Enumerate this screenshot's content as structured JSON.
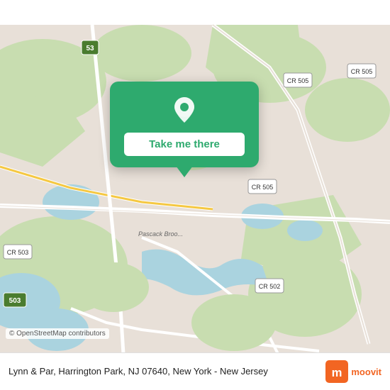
{
  "map": {
    "alt": "Map of Harrington Park, NJ area"
  },
  "popup": {
    "button_label": "Take me there"
  },
  "bottom_bar": {
    "address": "Lynn & Par, Harrington Park, NJ 07640, New York - New Jersey",
    "osm_credit": "© OpenStreetMap contributors"
  },
  "moovit": {
    "logo_text": "moovit"
  },
  "road_labels": {
    "cr505_top": "CR 505",
    "cr505_mid": "CR 505",
    "cr505_bot": "CR 505",
    "cr503": "CR 503",
    "cr502": "CR 502",
    "r53": "53",
    "r503": "503",
    "pascack": "Pascack Broo..."
  }
}
